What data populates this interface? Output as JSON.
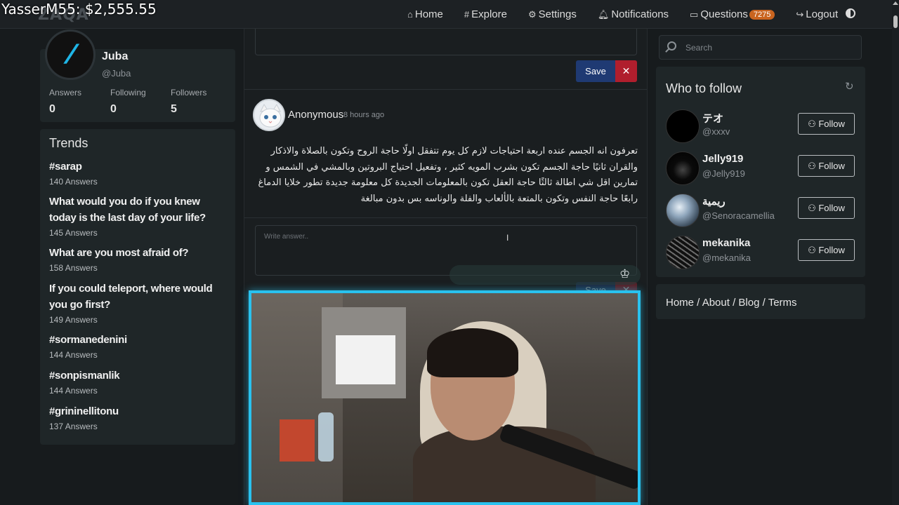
{
  "overlay": {
    "text": "YasserM55: $2,555.55"
  },
  "logo": {
    "text": "ZAQA"
  },
  "nav": {
    "home": "Home",
    "explore": "Explore",
    "settings": "Settings",
    "notifications": "Notifications",
    "questions": "Questions",
    "questions_badge": "7275",
    "logout": "Logout"
  },
  "profile": {
    "name": "Juba",
    "handle": "@Juba",
    "answers_label": "Answers",
    "answers": "0",
    "following_label": "Following",
    "following": "0",
    "followers_label": "Followers",
    "followers": "5"
  },
  "trends": {
    "title": "Trends",
    "items": [
      {
        "title": "#sarap",
        "count": "140 Answers"
      },
      {
        "title": "What would you do if you knew today is the last day of your life?",
        "count": "145 Answers"
      },
      {
        "title": "What are you most afraid of?",
        "count": "158 Answers"
      },
      {
        "title": "If you could teleport, where would you go first?",
        "count": "149 Answers"
      },
      {
        "title": "#sormanedenini",
        "count": "144 Answers"
      },
      {
        "title": "#sonpismanlik",
        "count": "144 Answers"
      },
      {
        "title": "#grininellitonu",
        "count": "137 Answers"
      }
    ]
  },
  "editor_top": {
    "save": "Save",
    "cancel": "✕"
  },
  "post": {
    "author": "Anonymous",
    "time": "8 hours ago",
    "body": "تعرفون انه الجسم عنده اربعة احتياجات لازم كل يوم تتفقل اولًا حاجة الروح وتكون بالصلاة والاذكار والقران ثانيًا حاجة الجسم تكون بشرب المويه كثير ، وتفعيل احتياج البروتين وبالمشي في الشمس و تمارين اقل شي اطالة ثالثًا حاجة العقل تكون بالمعلومات الجديدة كل معلومة جديدة تطور خلايا الدماغ رابعًا حاجة النفس وتكون بالمتعة بالألعاب والفلة والوناسه بس بدون مبالغة"
  },
  "answer": {
    "placeholder": "Write answer..",
    "save": "Save",
    "cancel": "✕"
  },
  "search": {
    "placeholder": "Search"
  },
  "who_to_follow": {
    "title": "Who to follow",
    "follow_label": "Follow",
    "users": [
      {
        "name": "テオ",
        "handle": "@xxxv"
      },
      {
        "name": "Jelly919",
        "handle": "@Jelly919"
      },
      {
        "name": "ريمية",
        "handle": "@Senoracamellia"
      },
      {
        "name": "mekanika",
        "handle": "@mekanika"
      }
    ]
  },
  "footer": {
    "home": "Home",
    "about": "About",
    "blog": "Blog",
    "terms": "Terms",
    "sep": " / "
  }
}
